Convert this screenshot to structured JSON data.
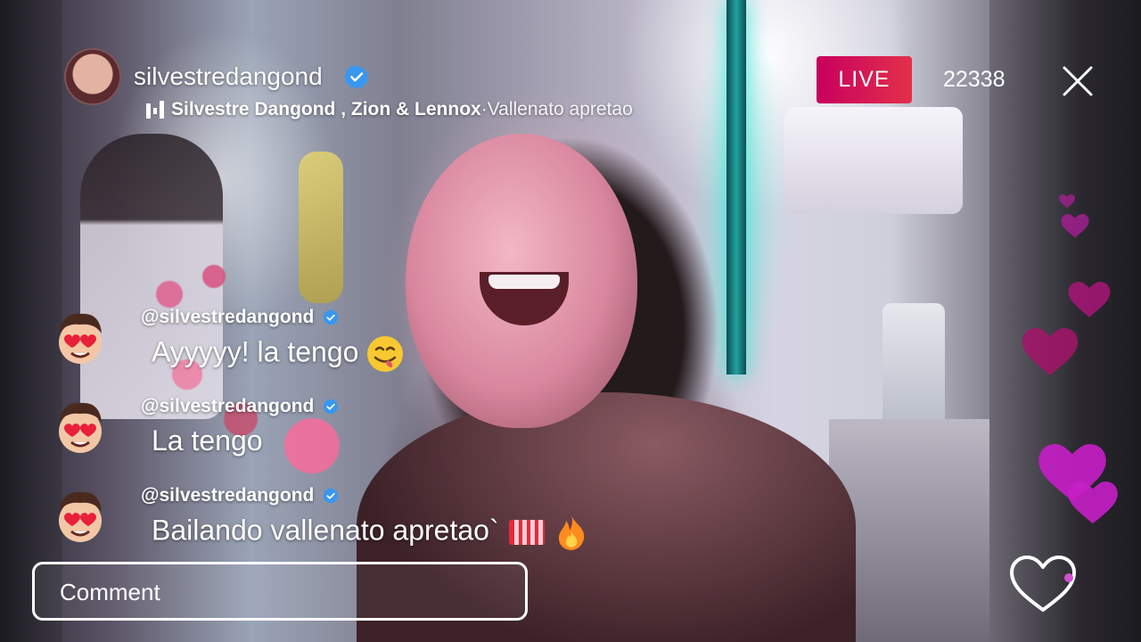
{
  "stream": {
    "username": "silvestredangond",
    "song_artists": "Silvestre Dangond , Zion & Lennox",
    "song_separator": " · ",
    "song_title": "Vallenato apretao",
    "live_label": "LIVE",
    "viewer_count": "22338"
  },
  "comments": [
    {
      "user": "@silvestredangond",
      "text": "Ayyyyy! la tengo",
      "emoji": [
        "yum-face"
      ]
    },
    {
      "user": "@silvestredangond",
      "text": "La tengo",
      "emoji": []
    },
    {
      "user": "@silvestredangond",
      "text": "Bailando vallenato apretao`",
      "emoji": [
        "accordion",
        "fire"
      ]
    }
  ],
  "comment_input": {
    "placeholder": "Comment"
  },
  "icons": {
    "verified": "verified-badge-icon",
    "close": "close-icon",
    "like": "heart-outline-icon",
    "music": "music-bars-icon"
  },
  "colors": {
    "live_badge_start": "#c8005e",
    "live_badge_end": "#e2304a",
    "verified_blue": "#3897f0",
    "heart_magenta": "#c81ec8"
  }
}
